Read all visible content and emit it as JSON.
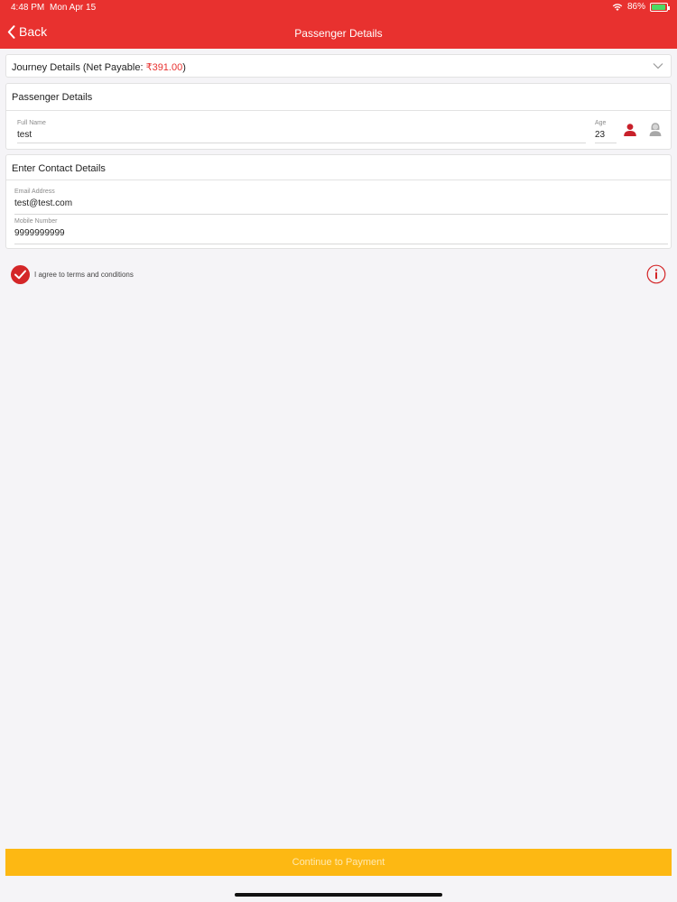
{
  "status_bar": {
    "time": "4:48 PM",
    "date": "Mon Apr 15",
    "battery": "86%",
    "wifi_icon": "wifi-icon",
    "battery_icon": "battery-icon"
  },
  "nav": {
    "back_label": "Back",
    "title": "Passenger Details",
    "back_icon": "chevron-left-icon"
  },
  "journey": {
    "label": "Journey Details (Net Payable: ",
    "amount": "₹391.00",
    "suffix": ")",
    "expand_icon": "chevron-down-icon"
  },
  "passenger": {
    "section_title": "Passenger Details",
    "full_name_label": "Full Name",
    "full_name_value": "test",
    "age_label": "Age",
    "age_value": "23",
    "male_icon": "male-user-icon",
    "female_icon": "female-user-icon"
  },
  "contact": {
    "section_title": "Enter Contact Details",
    "email_label": "Email Address",
    "email_value": "test@test.com",
    "mobile_label": "Mobile Number",
    "mobile_value": "9999999999"
  },
  "terms": {
    "label": "I agree to terms and conditions",
    "checked": true,
    "check_icon": "checkmark-icon",
    "info_icon": "info-icon"
  },
  "cta": {
    "label": "Continue to Payment"
  },
  "colors": {
    "brand_red": "#e8312f",
    "cta_yellow": "#fdb813"
  }
}
